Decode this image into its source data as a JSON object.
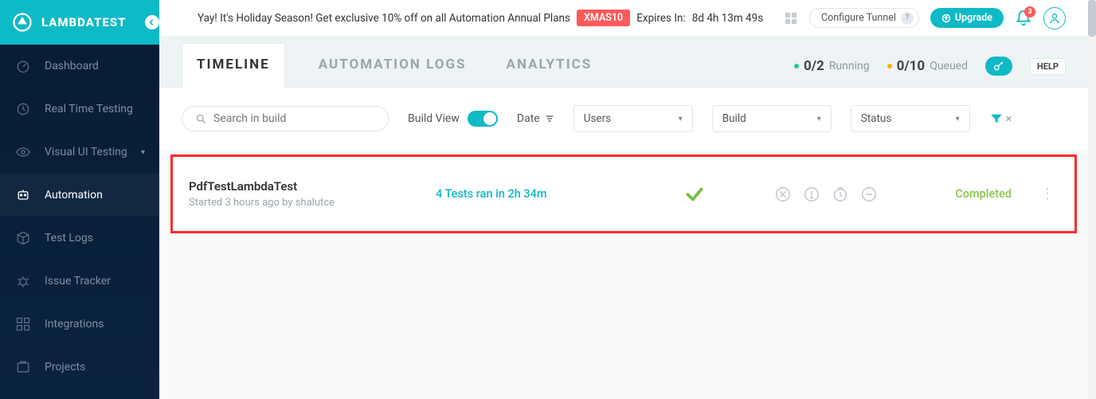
{
  "brand": {
    "name": "LAMBDATEST"
  },
  "sidebar": {
    "items": [
      {
        "label": "Dashboard"
      },
      {
        "label": "Real Time Testing"
      },
      {
        "label": "Visual UI Testing"
      },
      {
        "label": "Automation"
      },
      {
        "label": "Test Logs"
      },
      {
        "label": "Issue Tracker"
      },
      {
        "label": "Integrations"
      },
      {
        "label": "Projects"
      }
    ]
  },
  "banner": {
    "text": "Yay! It's Holiday Season! Get exclusive 10% off on all Automation Annual Plans",
    "coupon": "XMAS10",
    "expires_label": "Expires In:",
    "expires_value": "8d 4h 13m 49s",
    "configure_tunnel": "Configure Tunnel",
    "upgrade": "Upgrade",
    "notif_count": "3"
  },
  "tabs": {
    "items": [
      {
        "label": "TIMELINE"
      },
      {
        "label": "AUTOMATION LOGS"
      },
      {
        "label": "ANALYTICS"
      }
    ]
  },
  "stats": {
    "running_value": "0/2",
    "running_label": "Running",
    "queued_value": "0/10",
    "queued_label": "Queued",
    "help": "HELP"
  },
  "filters": {
    "search_placeholder": "Search in build",
    "build_view_label": "Build View",
    "date_label": "Date",
    "users_label": "Users",
    "build_label": "Build",
    "status_label": "Status"
  },
  "build": {
    "name": "PdfTestLambdaTest",
    "subtitle": "Started 3 hours ago by shalutce",
    "tests_summary": "4 Tests ran in 2h 34m",
    "status": "Completed"
  }
}
